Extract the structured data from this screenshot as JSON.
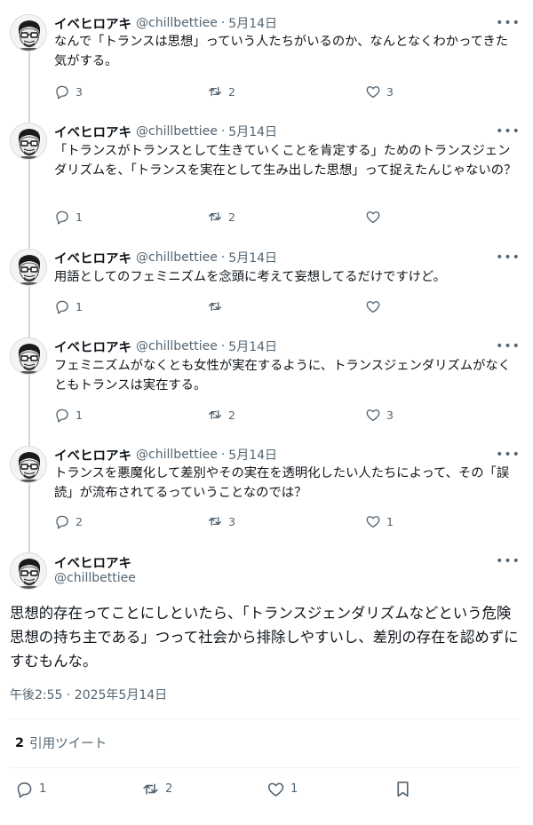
{
  "replies": [
    {
      "name": "イベヒロアキ",
      "handle": "@chillbettiee",
      "separator": "·",
      "date": "5月14日",
      "more_icon": "more-icon",
      "text": "なんで「トランスは思想」っていう人たちがいるのか、なんとなくわかってきた気がする。",
      "reply_count": "3",
      "retweet_count": "2",
      "like_count": "3"
    },
    {
      "name": "イベヒロアキ",
      "handle": "@chillbettiee",
      "separator": "·",
      "date": "5月14日",
      "more_icon": "more-icon",
      "text": "「トランスがトランスとして生きていくことを肯定する」ためのトランスジェンダリズムを、「トランスを実在として生み出した思想」って捉えたんじゃないの？",
      "reply_count": "1",
      "retweet_count": "2",
      "like_count": ""
    },
    {
      "name": "イベヒロアキ",
      "handle": "@chillbettiee",
      "separator": "·",
      "date": "5月14日",
      "more_icon": "more-icon",
      "text": "用語としてのフェミニズムを念頭に考えて妄想してるだけですけど。",
      "reply_count": "1",
      "retweet_count": "",
      "like_count": ""
    },
    {
      "name": "イベヒロアキ",
      "handle": "@chillbettiee",
      "separator": "·",
      "date": "5月14日",
      "more_icon": "more-icon",
      "text": "フェミニズムがなくとも女性が実在するように、トランスジェンダリズムがなくともトランスは実在する。",
      "reply_count": "1",
      "retweet_count": "2",
      "like_count": "3"
    },
    {
      "name": "イベヒロアキ",
      "handle": "@chillbettiee",
      "separator": "·",
      "date": "5月14日",
      "more_icon": "more-icon",
      "text": "トランスを悪魔化して差別やその実在を透明化したい人たちによって、その「誤読」が流布されてるっていうことなのでは？",
      "reply_count": "2",
      "retweet_count": "3",
      "like_count": "1"
    }
  ],
  "main": {
    "name": "イベヒロアキ",
    "handle": "@chillbettiee",
    "text": "思想的存在ってことにしといたら、「トランスジェンダリズムなどという危険思想の持ち主である」つって社会から排除しやすいし、差別の存在を認めずにすむもんな。",
    "timestamp": "午後2:55 · 2025年5月14日",
    "quote_count": "2",
    "quote_label": "引用ツイート",
    "reply_count": "1",
    "retweet_count": "2",
    "like_count": "1"
  },
  "icons": {
    "reply": "reply-icon",
    "retweet": "retweet-icon",
    "like": "like-icon",
    "bookmark": "bookmark-icon"
  },
  "colors": {
    "text": "#0f1419",
    "secondary": "#536471",
    "thread_line": "#cfd9de",
    "divider": "#eff3f4"
  }
}
